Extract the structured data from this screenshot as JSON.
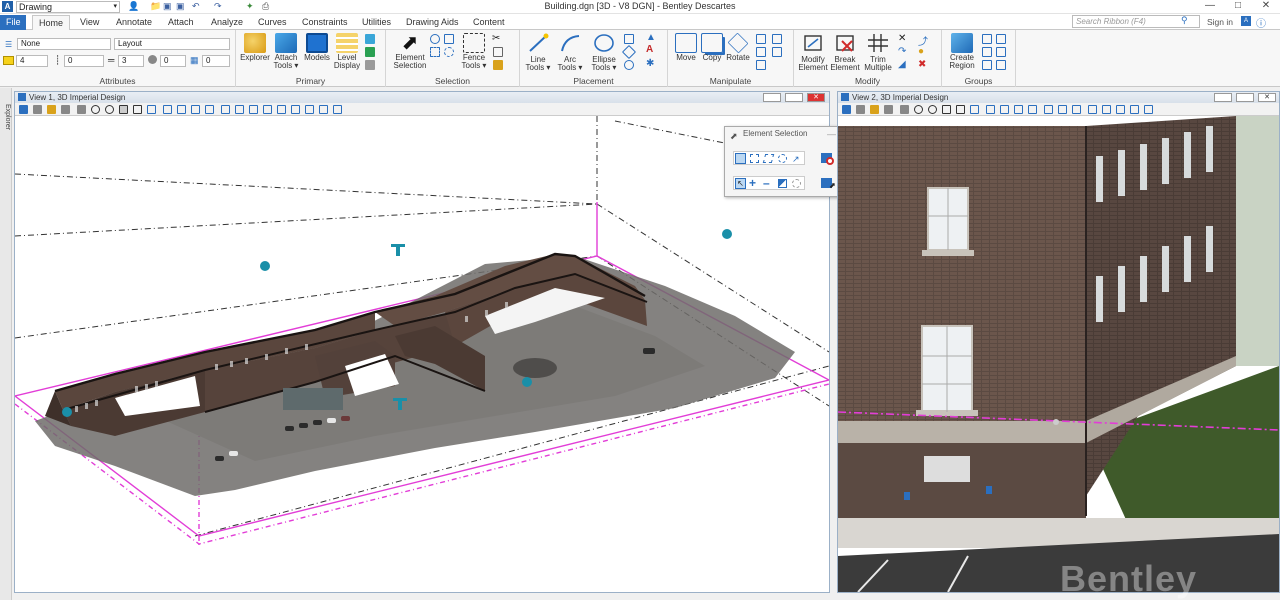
{
  "titlebar": {
    "workspace": "Drawing",
    "title": "Building.dgn [3D - V8 DGN] - Bentley Descartes"
  },
  "tabs": [
    {
      "label": "File"
    },
    {
      "label": "Home"
    },
    {
      "label": "View"
    },
    {
      "label": "Annotate"
    },
    {
      "label": "Attach"
    },
    {
      "label": "Analyze"
    },
    {
      "label": "Curves"
    },
    {
      "label": "Constraints"
    },
    {
      "label": "Utilities"
    },
    {
      "label": "Drawing Aids"
    },
    {
      "label": "Content"
    }
  ],
  "ribbon_search": {
    "placeholder": "Search Ribbon (F4)"
  },
  "signin": "Sign in",
  "attributes": {
    "level": "None",
    "template": "Layout",
    "color": "4",
    "linestyle": "0",
    "weight": "3",
    "transparency": "0",
    "priority": "0",
    "label": "Attributes"
  },
  "primary": {
    "label": "Primary",
    "explorer": "Explorer",
    "attach_tools_1": "Attach",
    "attach_tools_2": "Tools ▾",
    "models": "Models",
    "level_display_1": "Level",
    "level_display_2": "Display"
  },
  "selection": {
    "label": "Selection",
    "element_selection_1": "Element",
    "element_selection_2": "Selection",
    "fence_tools_1": "Fence",
    "fence_tools_2": "Tools ▾"
  },
  "placement": {
    "label": "Placement",
    "line_tools_1": "Line",
    "line_tools_2": "Tools ▾",
    "arc_tools_1": "Arc",
    "arc_tools_2": "Tools ▾",
    "ellipse_tools_1": "Ellipse",
    "ellipse_tools_2": "Tools ▾"
  },
  "manipulate": {
    "label": "Manipulate",
    "move": "Move",
    "copy": "Copy",
    "rotate": "Rotate"
  },
  "modify": {
    "label": "Modify",
    "modify_element_1": "Modify",
    "modify_element_2": "Element",
    "break_element_1": "Break",
    "break_element_2": "Element",
    "trim_multiple_1": "Trim",
    "trim_multiple_2": "Multiple"
  },
  "groups": {
    "label": "Groups",
    "create_region_1": "Create",
    "create_region_2": "Region"
  },
  "view1": {
    "title": "View 1, 3D Imperial Design"
  },
  "view2": {
    "title": "View 2, 3D Imperial Design"
  },
  "element_selection_dialog": {
    "title": "Element Selection"
  },
  "left_strip": {
    "label": "Explorer"
  },
  "watermark": "Bentley",
  "colors": {
    "accent": "#2b6fbf",
    "magenta": "#e23dd7",
    "titlebar_view": "#dde5ee"
  }
}
